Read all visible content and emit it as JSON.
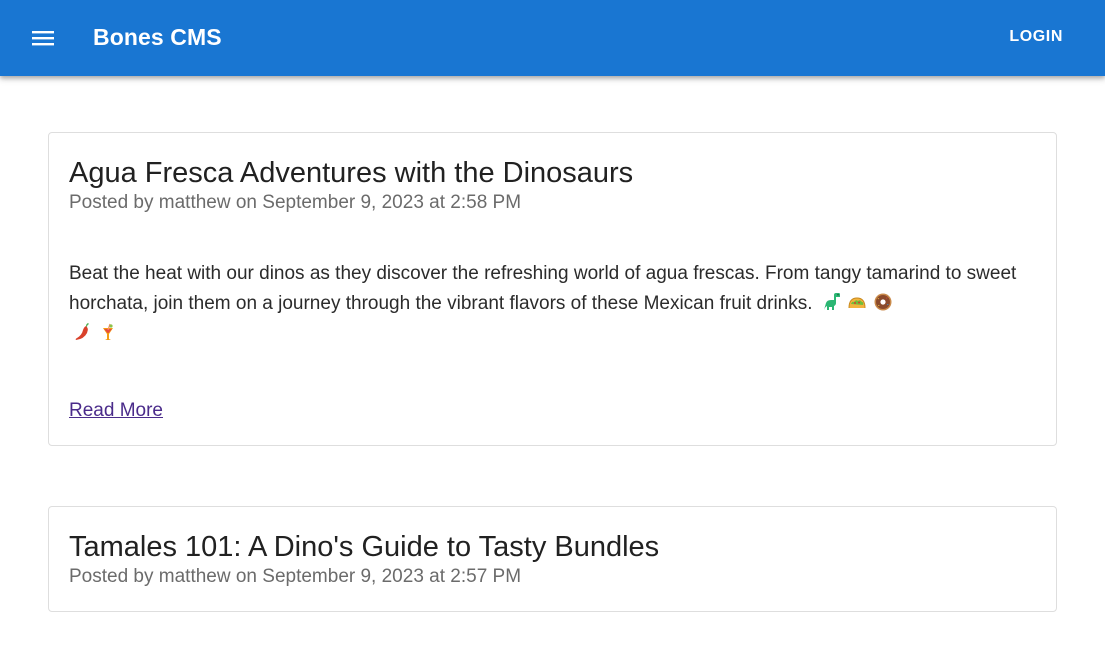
{
  "app": {
    "title": "Bones CMS",
    "login_label": "LOGIN",
    "menu_icon": "menu-icon",
    "accent": "#1976d2"
  },
  "posts": [
    {
      "title": "Agua Fresca Adventures with the Dinosaurs",
      "meta": "Posted by matthew on September 9, 2023 at 2:58 PM",
      "excerpt": "Beat the heat with our dinos as they discover the refreshing world of agua frescas. From tangy tamarind to sweet horchata, join them on a journey through the vibrant flavors of these Mexican fruit drinks.",
      "emojis": [
        "dinosaur-icon",
        "taco-icon",
        "donut-icon",
        "chili-pepper-icon",
        "tropical-drink-icon"
      ],
      "link_label": "Read More"
    },
    {
      "title": "Tamales 101: A Dino's Guide to Tasty Bundles",
      "meta": "Posted by matthew on September 9, 2023 at 2:57 PM"
    }
  ]
}
